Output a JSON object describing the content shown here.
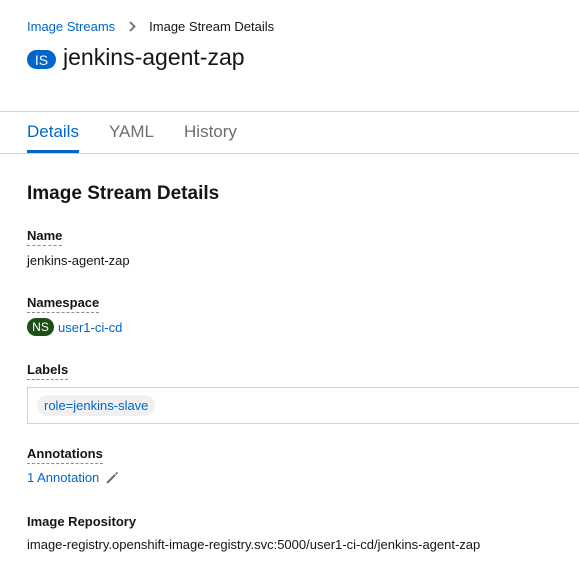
{
  "breadcrumb": {
    "parent": "Image Streams",
    "current": "Image Stream Details",
    "separator_icon": "chevron-right-icon"
  },
  "header": {
    "badge": "IS",
    "title": "jenkins-agent-zap"
  },
  "tabs": [
    {
      "label": "Details",
      "active": true
    },
    {
      "label": "YAML",
      "active": false
    },
    {
      "label": "History",
      "active": false
    }
  ],
  "details": {
    "section_title": "Image Stream Details",
    "name": {
      "label": "Name",
      "value": "jenkins-agent-zap"
    },
    "namespace": {
      "label": "Namespace",
      "badge": "NS",
      "value": "user1-ci-cd"
    },
    "labels": {
      "label": "Labels",
      "items": [
        "role=jenkins-slave"
      ]
    },
    "annotations": {
      "label": "Annotations",
      "value": "1 Annotation",
      "edit_icon": "pencil-icon"
    },
    "image_repository": {
      "label": "Image Repository",
      "value": "image-registry.openshift-image-registry.svc:5000/user1-ci-cd/jenkins-agent-zap"
    }
  },
  "colors": {
    "link": "#0066cc",
    "ns_badge": "#1e4f18",
    "is_badge": "#0066cc",
    "divider": "#d2d2d2"
  }
}
